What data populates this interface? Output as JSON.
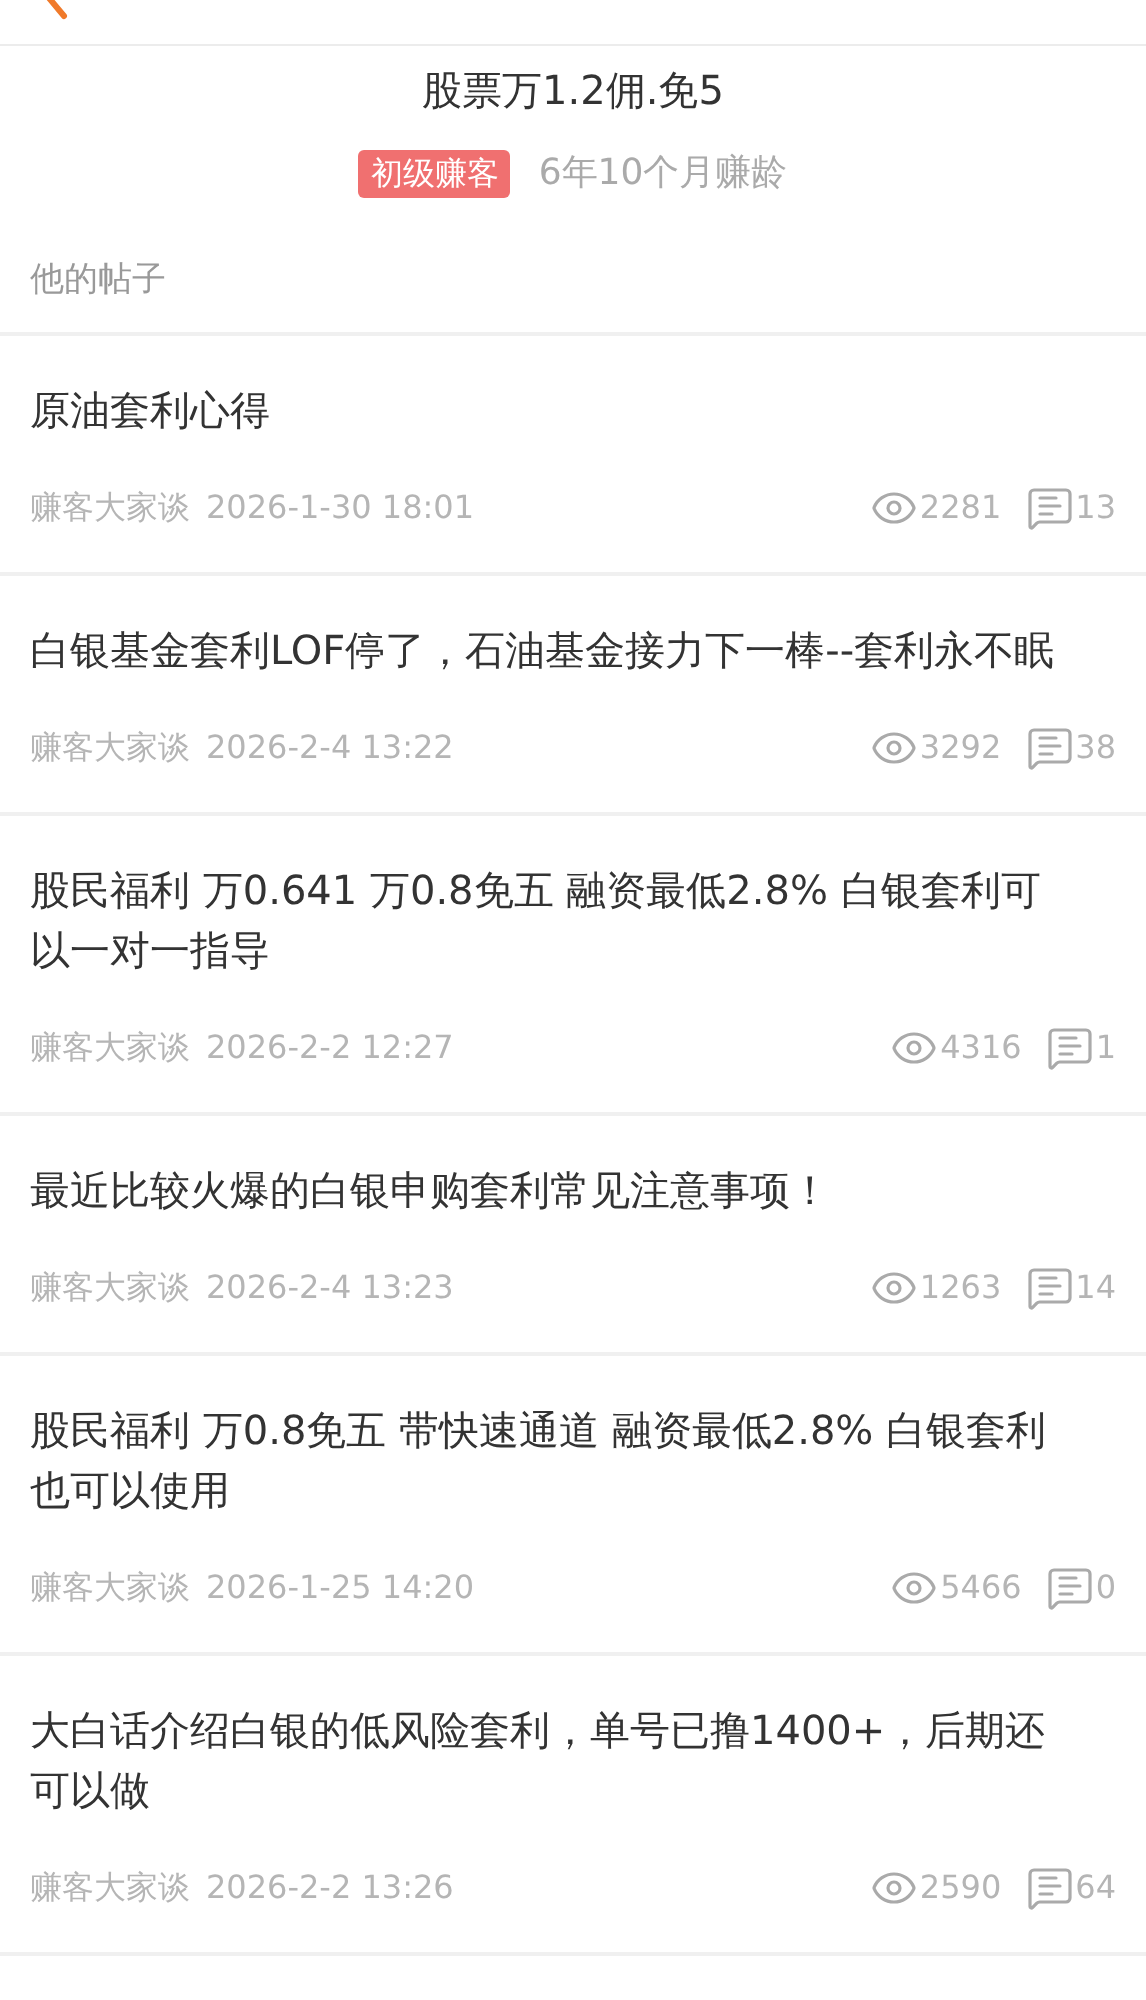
{
  "profile": {
    "name": "股票万1.2佣.免5",
    "badge": "初级赚客",
    "age": "6年10个月赚龄"
  },
  "section_title": "他的帖子",
  "posts": [
    {
      "title": "原油套利心得",
      "forum": "赚客大家谈",
      "time": "2026-1-30 18:01",
      "views": "2281",
      "comments": "13"
    },
    {
      "title": "白银基金套利LOF停了，石油基金接力下一棒--套利永不眠",
      "forum": "赚客大家谈",
      "time": "2026-2-4 13:22",
      "views": "3292",
      "comments": "38"
    },
    {
      "title": "股民福利 万0.641 万0.8免五  融资最低2.8% 白银套利可以一对一指导",
      "forum": "赚客大家谈",
      "time": "2026-2-2 12:27",
      "views": "4316",
      "comments": "1"
    },
    {
      "title": "最近比较火爆的白银申购套利常见注意事项！",
      "forum": "赚客大家谈",
      "time": "2026-2-4 13:23",
      "views": "1263",
      "comments": "14"
    },
    {
      "title": "股民福利  万0.8免五 带快速通道 融资最低2.8% 白银套利也可以使用",
      "forum": "赚客大家谈",
      "time": "2026-1-25 14:20",
      "views": "5466",
      "comments": "0"
    },
    {
      "title": "大白话介绍白银的低风险套利，单号已撸1400+，后期还可以做",
      "forum": "赚客大家谈",
      "time": "2026-2-2 13:26",
      "views": "2590",
      "comments": "64"
    }
  ]
}
